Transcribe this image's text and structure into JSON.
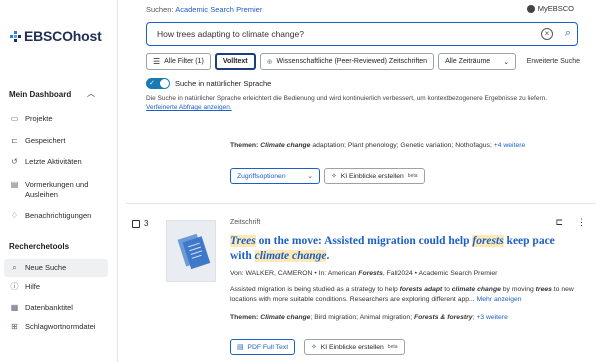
{
  "brand": {
    "logo_text": "EBSCOhost"
  },
  "sidebar": {
    "dashboard_title": "Mein Dashboard",
    "dashboard_items": [
      {
        "label": "Projekte",
        "icon": "folder-icon"
      },
      {
        "label": "Gespeichert",
        "icon": "bookmark-icon"
      },
      {
        "label": "Letzte Aktivitäten",
        "icon": "history-icon"
      },
      {
        "label": "Vormerkungen und Ausleihen",
        "icon": "book-icon"
      },
      {
        "label": "Benachrichtigungen",
        "icon": "bell-icon"
      }
    ],
    "tools_title": "Recherchetools",
    "tools_items": [
      {
        "label": "Neue Suche",
        "icon": "search-icon",
        "active": true
      },
      {
        "label": "Hilfe",
        "icon": "help-icon"
      },
      {
        "label": "Datenbanktitel",
        "icon": "database-icon"
      },
      {
        "label": "Schlagwortnormdatei",
        "icon": "tree-icon"
      }
    ]
  },
  "header": {
    "search_prefix": "Suchen:",
    "database": "Academic Search Premier",
    "account": "MyEBSCO"
  },
  "search": {
    "query": "How trees adapting to climate change?"
  },
  "filters": {
    "all_filters": "Alle Filter (1)",
    "fulltext": "Volltext",
    "peer_reviewed": "Wissenschaftliche (Peer-Reviewed) Zeitschriften",
    "time_range": "Alle Zeiträume",
    "advanced": "Erweiterte Suche"
  },
  "natural_language": {
    "label": "Suche in natürlicher Sprache",
    "description": "Die Suche in natürlicher Sprache erleichtert die Bedienung und wird kontinuierlich verbessert, um kontextbezogenere Ergebnisse zu liefern.",
    "refine_link": "Verfeinerte Abfrage anzeigen."
  },
  "prev_result": {
    "topics_label": "Themen:",
    "topics_highlight": "Climate change",
    "topics_rest": " adaptation; Plant phenology; Genetic variation; Nothofagus;",
    "more": "+4 weitere",
    "access_button": "Zugriffsoptionen",
    "ai_button": "KI Einblicke erstellen",
    "beta": "beta"
  },
  "result": {
    "number": "3",
    "type": "Zeitschrift",
    "title_parts": [
      {
        "t": "Trees",
        "hl": true
      },
      {
        "t": " on the move: Assisted migration could help ",
        "hl": false
      },
      {
        "t": "forests",
        "hl": true
      },
      {
        "t": " keep pace with ",
        "hl": false
      },
      {
        "t": "climate change",
        "hl": true
      },
      {
        "t": ".",
        "hl": false
      }
    ],
    "meta_prefix": "Von: WALKER, CAMERON • In: American",
    "meta_journal": "Forests",
    "meta_suffix": ", Fall2024 • Academic Search Premier",
    "abstract_1": "Assisted migration is being studied as a strategy to help ",
    "abstract_b1": "forests adapt",
    "abstract_2": " to ",
    "abstract_b2": "climate change",
    "abstract_3": " by moving ",
    "abstract_b3": "trees",
    "abstract_4": " to new locations with more suitable conditions. Researchers are exploring different app...",
    "more_link": "Mehr anzeigen",
    "topics_label": "Themen:",
    "topics_highlight": "Climate change",
    "topics_mid": "; Bird migration; Animal migration;",
    "topics_bold2": "Forests & forestry",
    "topics_end": ";",
    "topics_more": "+3 weitere",
    "pdf_button": "PDF Full Text",
    "ai_button": "KI Einblicke erstellen",
    "beta": "beta"
  },
  "colors": {
    "link": "#1c5fc6",
    "toggle": "#1a7bb0",
    "highlight": "#fde9b5",
    "brand": "#1f2f55"
  }
}
